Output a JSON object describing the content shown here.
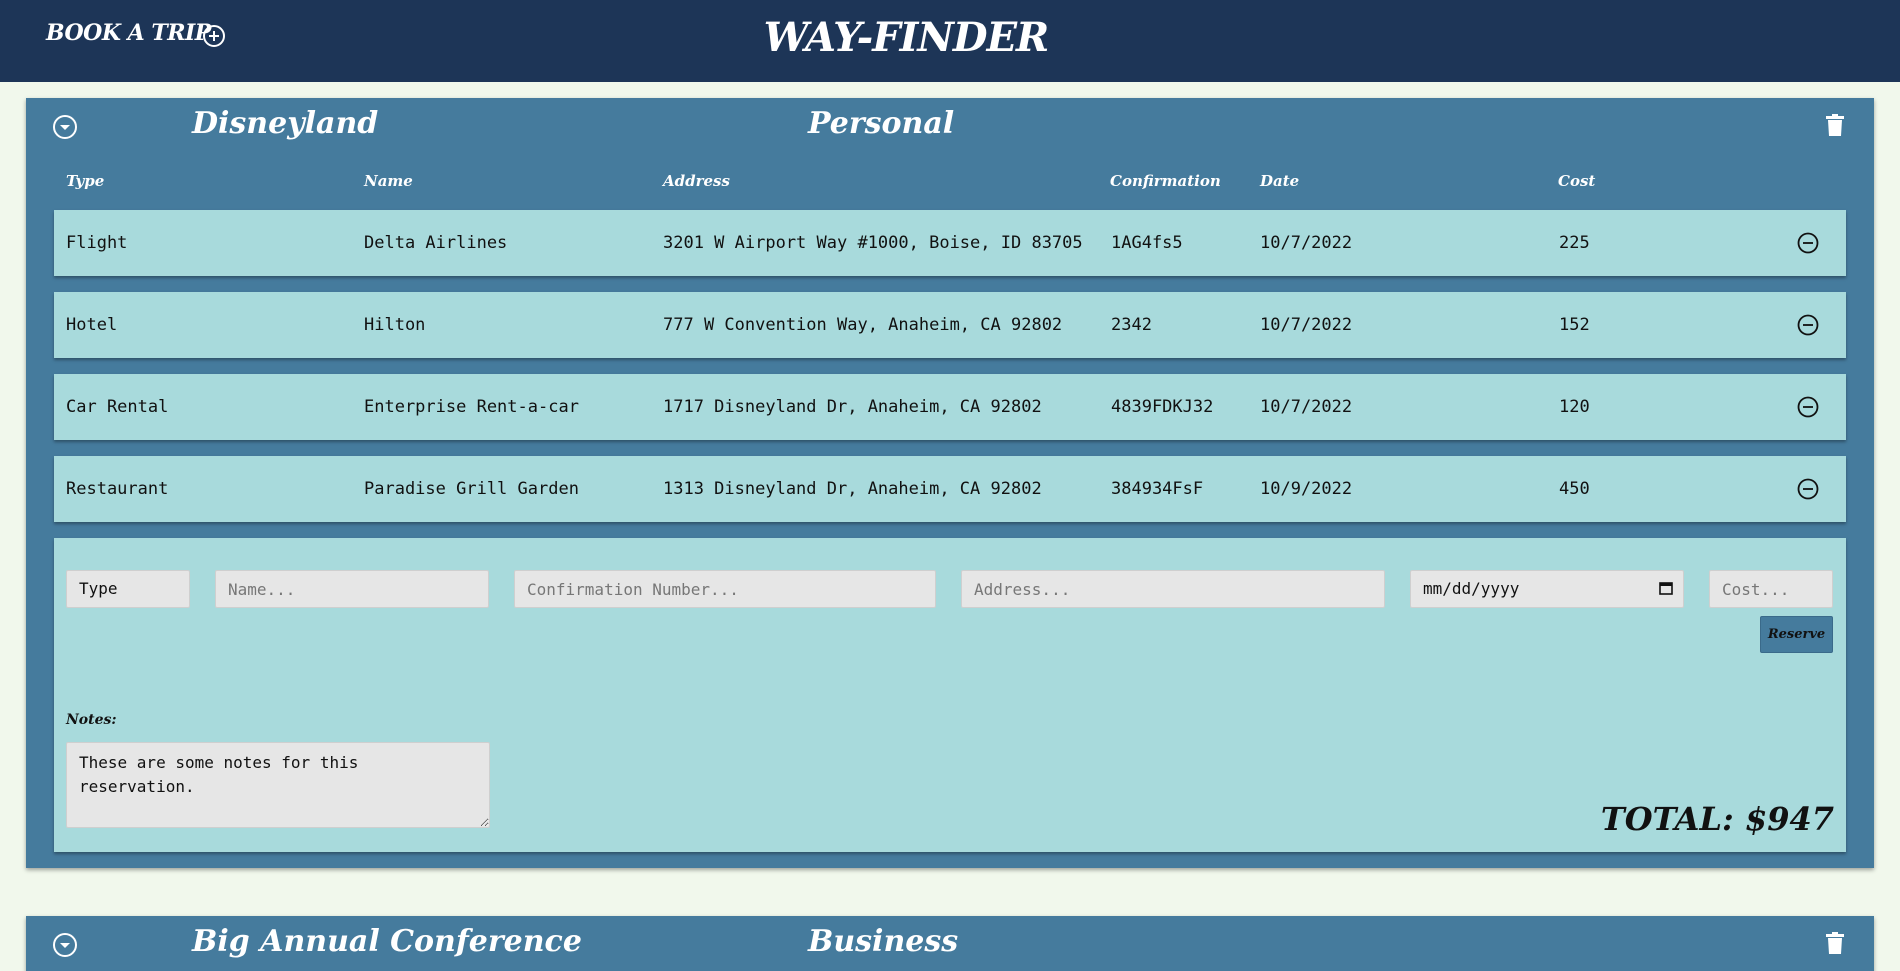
{
  "header": {
    "book_trip_label": "BOOK A TRIP",
    "brand": "WAY-FINDER",
    "bg_color": "#1d3557"
  },
  "columns": [
    "Type",
    "Name",
    "Address",
    "Confirmation",
    "Date",
    "Cost"
  ],
  "trips": [
    {
      "title": "Disneyland",
      "category": "Personal",
      "reservations": [
        {
          "type": "Flight",
          "name": "Delta Airlines",
          "address": "3201 W Airport Way #1000, Boise, ID 83705",
          "confirmation": "1AG4fs5",
          "date": "10/7/2022",
          "cost": "225"
        },
        {
          "type": "Hotel",
          "name": "Hilton",
          "address": "777 W Convention Way, Anaheim, CA 92802",
          "confirmation": "2342",
          "date": "10/7/2022",
          "cost": "152"
        },
        {
          "type": "Car Rental",
          "name": "Enterprise Rent-a-car",
          "address": "1717 Disneyland Dr, Anaheim, CA 92802",
          "confirmation": "4839FDKJ32",
          "date": "10/7/2022",
          "cost": "120"
        },
        {
          "type": "Restaurant",
          "name": "Paradise Grill Garden",
          "address": "1313 Disneyland Dr, Anaheim, CA 92802",
          "confirmation": "384934FsF",
          "date": "10/9/2022",
          "cost": "450"
        }
      ],
      "form": {
        "type_value": "Type",
        "name_placeholder": "Name...",
        "confirmation_placeholder": "Confirmation Number...",
        "address_placeholder": "Address...",
        "date_placeholder": "mm/dd/yyyy",
        "cost_placeholder": "Cost...",
        "reserve_label": "Reserve",
        "notes_label": "Notes:",
        "notes_value": "These are some notes for this reservation."
      },
      "total": "TOTAL: $947"
    },
    {
      "title": "Big Annual Conference",
      "category": "Business"
    }
  ],
  "colors": {
    "page_bg": "#f1f8ec",
    "card_bg": "#457b9d",
    "row_bg": "#a8dadc",
    "input_bg": "#e6e6e6"
  },
  "icons": {
    "add": "plus-circle-icon",
    "collapse": "chevron-down-circle-icon",
    "delete_trip": "trash-icon",
    "remove_row": "minus-circle-icon",
    "date": "calendar-icon"
  }
}
